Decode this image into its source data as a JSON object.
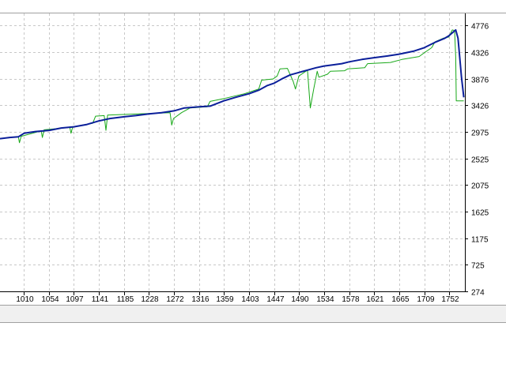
{
  "colors": {
    "balance": "#0b1f9a",
    "equity": "#18a818",
    "grid": "#c8c8c8",
    "axis": "#000000",
    "background": "#ffffff"
  },
  "chart_data": {
    "type": "line",
    "title": "",
    "xlabel": "",
    "ylabel": "",
    "grid": true,
    "legend": "none",
    "xlim": [
      968,
      1780
    ],
    "ylim": [
      274,
      4980
    ],
    "x_ticks": [
      1010,
      1054,
      1097,
      1141,
      1185,
      1228,
      1272,
      1316,
      1359,
      1403,
      1447,
      1490,
      1534,
      1578,
      1621,
      1665,
      1709,
      1752
    ],
    "y_ticks": [
      274,
      725,
      1175,
      1625,
      2075,
      2525,
      2975,
      3426,
      3876,
      4326,
      4776
    ],
    "series": [
      {
        "key": "balance",
        "values": [
          [
            968,
            2860
          ],
          [
            985,
            2880
          ],
          [
            1000,
            2890
          ],
          [
            1010,
            2950
          ],
          [
            1030,
            2980
          ],
          [
            1054,
            3000
          ],
          [
            1075,
            3040
          ],
          [
            1097,
            3060
          ],
          [
            1120,
            3100
          ],
          [
            1141,
            3160
          ],
          [
            1160,
            3200
          ],
          [
            1185,
            3230
          ],
          [
            1205,
            3250
          ],
          [
            1228,
            3280
          ],
          [
            1250,
            3300
          ],
          [
            1272,
            3330
          ],
          [
            1290,
            3380
          ],
          [
            1316,
            3400
          ],
          [
            1335,
            3410
          ],
          [
            1359,
            3500
          ],
          [
            1380,
            3560
          ],
          [
            1403,
            3620
          ],
          [
            1420,
            3680
          ],
          [
            1435,
            3760
          ],
          [
            1447,
            3800
          ],
          [
            1462,
            3880
          ],
          [
            1475,
            3940
          ],
          [
            1490,
            3980
          ],
          [
            1505,
            4020
          ],
          [
            1520,
            4060
          ],
          [
            1534,
            4090
          ],
          [
            1550,
            4110
          ],
          [
            1565,
            4130
          ],
          [
            1578,
            4160
          ],
          [
            1600,
            4200
          ],
          [
            1621,
            4230
          ],
          [
            1645,
            4260
          ],
          [
            1665,
            4290
          ],
          [
            1690,
            4340
          ],
          [
            1709,
            4400
          ],
          [
            1730,
            4500
          ],
          [
            1745,
            4560
          ],
          [
            1752,
            4600
          ],
          [
            1764,
            4700
          ],
          [
            1768,
            4560
          ],
          [
            1774,
            3900
          ],
          [
            1778,
            3560
          ]
        ]
      },
      {
        "key": "equity",
        "values": [
          [
            968,
            2860
          ],
          [
            1000,
            2890
          ],
          [
            1002,
            2790
          ],
          [
            1005,
            2900
          ],
          [
            1040,
            2990
          ],
          [
            1042,
            2880
          ],
          [
            1045,
            3010
          ],
          [
            1090,
            3050
          ],
          [
            1092,
            2950
          ],
          [
            1095,
            3060
          ],
          [
            1130,
            3120
          ],
          [
            1135,
            3240
          ],
          [
            1150,
            3250
          ],
          [
            1153,
            3000
          ],
          [
            1156,
            3260
          ],
          [
            1210,
            3280
          ],
          [
            1265,
            3300
          ],
          [
            1268,
            3090
          ],
          [
            1271,
            3200
          ],
          [
            1285,
            3300
          ],
          [
            1300,
            3380
          ],
          [
            1330,
            3400
          ],
          [
            1335,
            3490
          ],
          [
            1360,
            3540
          ],
          [
            1395,
            3620
          ],
          [
            1420,
            3700
          ],
          [
            1425,
            3850
          ],
          [
            1445,
            3870
          ],
          [
            1452,
            3920
          ],
          [
            1457,
            4040
          ],
          [
            1470,
            4050
          ],
          [
            1480,
            3830
          ],
          [
            1484,
            3700
          ],
          [
            1490,
            3920
          ],
          [
            1505,
            4020
          ],
          [
            1510,
            3380
          ],
          [
            1516,
            3700
          ],
          [
            1522,
            4000
          ],
          [
            1525,
            3900
          ],
          [
            1540,
            3950
          ],
          [
            1545,
            4000
          ],
          [
            1570,
            4010
          ],
          [
            1575,
            4040
          ],
          [
            1605,
            4060
          ],
          [
            1610,
            4130
          ],
          [
            1650,
            4150
          ],
          [
            1670,
            4200
          ],
          [
            1700,
            4250
          ],
          [
            1710,
            4320
          ],
          [
            1722,
            4400
          ],
          [
            1728,
            4500
          ],
          [
            1742,
            4560
          ],
          [
            1752,
            4580
          ],
          [
            1758,
            4700
          ],
          [
            1762,
            4690
          ],
          [
            1764,
            4240
          ],
          [
            1765,
            3500
          ],
          [
            1778,
            3500
          ]
        ]
      }
    ]
  }
}
